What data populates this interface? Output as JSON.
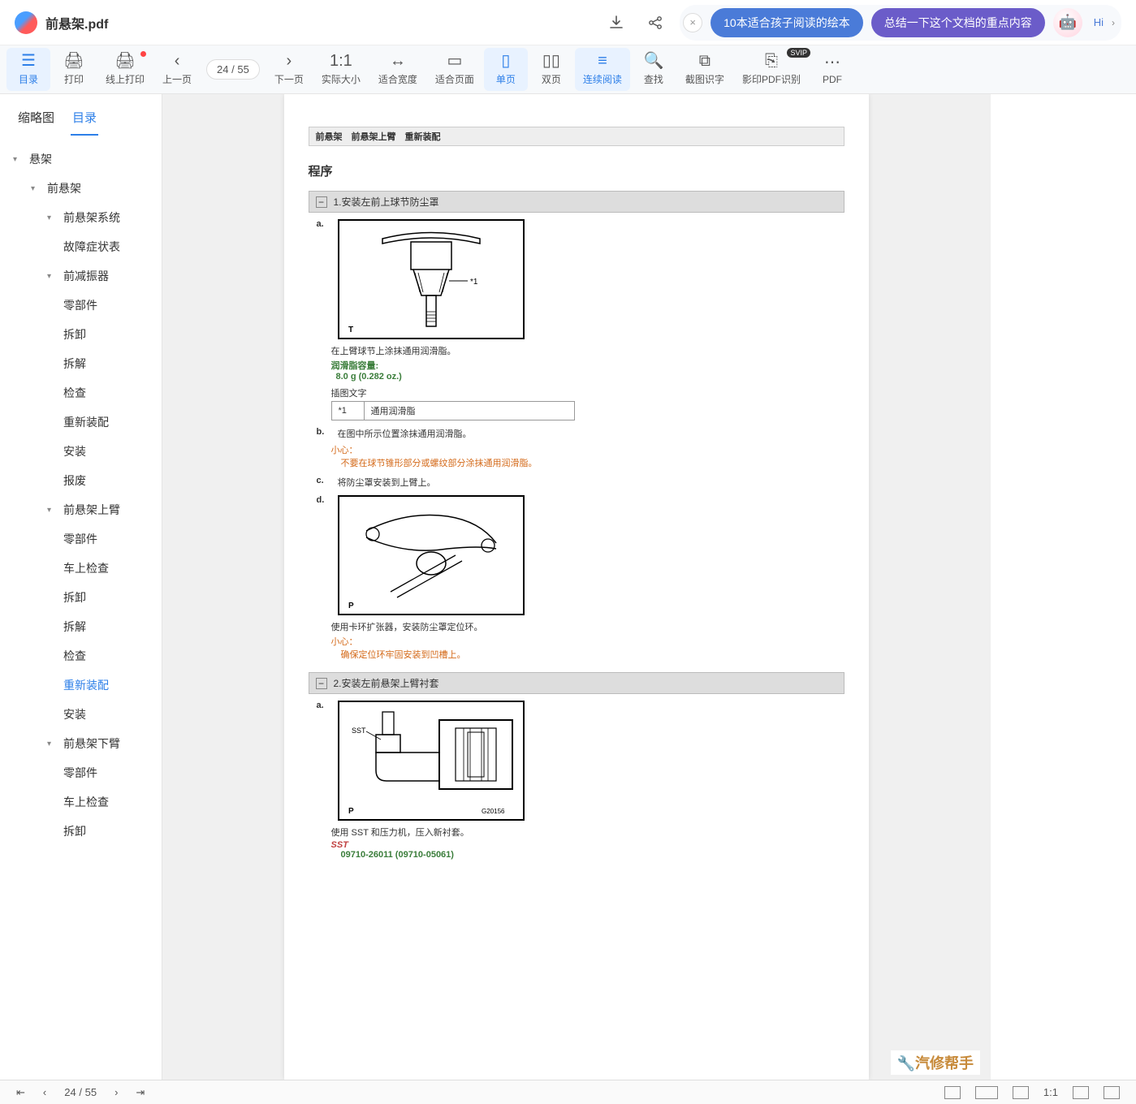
{
  "header": {
    "filename": "前悬架.pdf",
    "ai_pill_1": "10本适合孩子阅读的绘本",
    "ai_pill_2": "总结一下这个文档的重点内容",
    "hi": "Hi"
  },
  "toolbar": {
    "toc": "目录",
    "print": "打印",
    "online_print": "线上打印",
    "prev_page": "上一页",
    "page_current": "24",
    "page_sep": "/",
    "page_total": "55",
    "next_page": "下一页",
    "actual_size": "实际大小",
    "fit_width": "适合宽度",
    "fit_page": "适合页面",
    "single": "单页",
    "double": "双页",
    "continuous": "连续阅读",
    "find": "查找",
    "ocr_screenshot": "截图识字",
    "ocr_pdf": "影印PDF识别",
    "pdf_more": "PDF",
    "badge": "SVIP"
  },
  "sidebar": {
    "tab_thumb": "缩略图",
    "tab_toc": "目录",
    "items": [
      {
        "label": "悬架",
        "level": 0,
        "caret": true
      },
      {
        "label": "前悬架",
        "level": 1,
        "caret": true
      },
      {
        "label": "前悬架系统",
        "level": 2,
        "caret": true
      },
      {
        "label": "故障症状表",
        "level": 3
      },
      {
        "label": "前减振器",
        "level": 2,
        "caret": true
      },
      {
        "label": "零部件",
        "level": 3
      },
      {
        "label": "拆卸",
        "level": 3
      },
      {
        "label": "拆解",
        "level": 3
      },
      {
        "label": "检查",
        "level": 3
      },
      {
        "label": "重新装配",
        "level": 3
      },
      {
        "label": "安装",
        "level": 3
      },
      {
        "label": "报废",
        "level": 3
      },
      {
        "label": "前悬架上臂",
        "level": 2,
        "caret": true
      },
      {
        "label": "零部件",
        "level": 3
      },
      {
        "label": "车上检查",
        "level": 3
      },
      {
        "label": "拆卸",
        "level": 3
      },
      {
        "label": "拆解",
        "level": 3
      },
      {
        "label": "检查",
        "level": 3
      },
      {
        "label": "重新装配",
        "level": 3,
        "active": true
      },
      {
        "label": "安装",
        "level": 3
      },
      {
        "label": "前悬架下臂",
        "level": 2,
        "caret": true
      },
      {
        "label": "零部件",
        "level": 3
      },
      {
        "label": "车上检查",
        "level": 3
      },
      {
        "label": "拆卸",
        "level": 3
      }
    ]
  },
  "doc": {
    "breadcrumb": "前悬架　前悬架上臂　重新装配",
    "section_title": "程序",
    "step1": {
      "header": "1.安装左前上球节防尘罩",
      "a": "a.",
      "a_note": "在上臂球节上涂抹通用润滑脂。",
      "grease_label": "润滑脂容量:",
      "grease_value": "8.0 g (0.282 oz.)",
      "fig_caption": "插图文字",
      "tbl_k": "*1",
      "tbl_v": "通用润滑脂",
      "b": "b.",
      "b_note": "在图中所示位置涂抹通用润滑脂。",
      "b_caution_label": "小心：",
      "b_caution": "不要在球节锥形部分或螺纹部分涂抹通用润滑脂。",
      "c": "c.",
      "c_note": "将防尘罩安装到上臂上。",
      "d": "d.",
      "d_note": "使用卡环扩张器，安装防尘罩定位环。",
      "d_caution_label": "小心：",
      "d_caution": "确保定位环牢固安装到凹槽上。"
    },
    "step2": {
      "header": "2.安装左前悬架上臂衬套",
      "a": "a.",
      "a_note": "使用 SST 和压力机，压入新衬套。",
      "sst_label": "SST",
      "sst_code": "09710-26011  (09710-05061)",
      "fig_id": "G20156"
    }
  },
  "bottombar": {
    "page_current": "24",
    "page_sep": "/",
    "page_total": "55",
    "ratio": "1:1"
  },
  "watermark": "汽修帮手"
}
